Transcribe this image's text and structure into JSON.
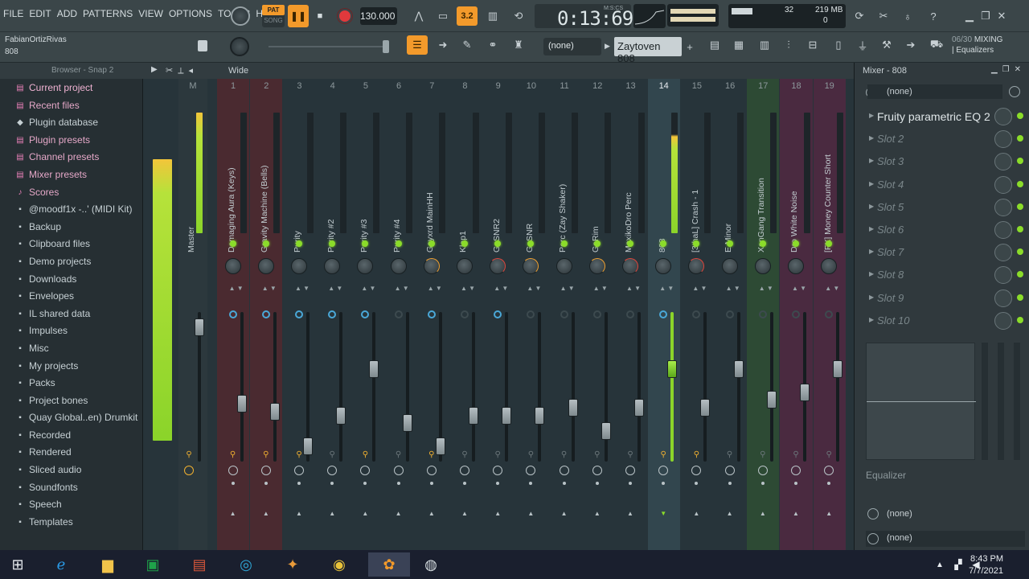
{
  "menus": [
    "FILE",
    "EDIT",
    "ADD",
    "PATTERNS",
    "VIEW",
    "OPTIONS",
    "TOOLS",
    "HELP"
  ],
  "transport": {
    "pat": "PAT",
    "song": "SONG",
    "tempo": "130.000",
    "time": "0:13:69",
    "time_unit": "M:S:CS",
    "step": "3.2"
  },
  "monitor": {
    "cpu_value": "32",
    "ram": "219 MB",
    "polyphony": "0"
  },
  "hint": {
    "user": "FabianOrtizRivas",
    "channel": "808"
  },
  "pattern": {
    "selector": "(none)",
    "name": "Zaytoven 808"
  },
  "mixing_info": {
    "count": "06/30",
    "mode": "MIXING",
    "sub": "| Equalizers"
  },
  "browser": {
    "title": "Browser - Snap 2",
    "items": [
      {
        "label": "Current project",
        "kind": "cur",
        "icon": "▤"
      },
      {
        "label": "Recent files",
        "kind": "pink",
        "icon": "▤"
      },
      {
        "label": "Plugin database",
        "kind": "normal",
        "icon": "◆"
      },
      {
        "label": "Plugin presets",
        "kind": "pink",
        "icon": "▤"
      },
      {
        "label": "Channel presets",
        "kind": "pink",
        "icon": "▤"
      },
      {
        "label": "Mixer presets",
        "kind": "pink",
        "icon": "▤"
      },
      {
        "label": "Scores",
        "kind": "pink",
        "icon": "♪"
      },
      {
        "label": "@moodf1x -..' (MIDI Kit)",
        "kind": "normal",
        "icon": "▪"
      },
      {
        "label": "Backup",
        "kind": "normal",
        "icon": "▪"
      },
      {
        "label": "Clipboard files",
        "kind": "normal",
        "icon": "▪"
      },
      {
        "label": "Demo projects",
        "kind": "normal",
        "icon": "▪"
      },
      {
        "label": "Downloads",
        "kind": "normal",
        "icon": "▪"
      },
      {
        "label": "Envelopes",
        "kind": "normal",
        "icon": "▪"
      },
      {
        "label": "IL shared data",
        "kind": "normal",
        "icon": "▪"
      },
      {
        "label": "Impulses",
        "kind": "normal",
        "icon": "▪"
      },
      {
        "label": "Misc",
        "kind": "normal",
        "icon": "▪"
      },
      {
        "label": "My projects",
        "kind": "normal",
        "icon": "▪"
      },
      {
        "label": "Packs",
        "kind": "normal",
        "icon": "▪"
      },
      {
        "label": "Project bones",
        "kind": "normal",
        "icon": "▪"
      },
      {
        "label": "Quay Global..en) Drumkit",
        "kind": "normal",
        "icon": "▪"
      },
      {
        "label": "Recorded",
        "kind": "normal",
        "icon": "▪"
      },
      {
        "label": "Rendered",
        "kind": "normal",
        "icon": "▪"
      },
      {
        "label": "Sliced audio",
        "kind": "normal",
        "icon": "▪"
      },
      {
        "label": "Soundfonts",
        "kind": "normal",
        "icon": "▪"
      },
      {
        "label": "Speech",
        "kind": "normal",
        "icon": "▪"
      },
      {
        "label": "Templates",
        "kind": "normal",
        "icon": "▪"
      }
    ]
  },
  "mixer": {
    "view": "Wide",
    "master": {
      "num": "M",
      "name": "Master"
    },
    "tracks": [
      {
        "num": "1",
        "name": "Damaging Aura (Keys)",
        "fader": 0.33,
        "tint": "#4a2a30",
        "stereo": true
      },
      {
        "num": "2",
        "name": "Gravity Machine (Bells)",
        "fader": 0.27,
        "tint": "#4a2a30",
        "stereo": true
      },
      {
        "num": "3",
        "name": "Purity",
        "fader": 0.0,
        "tint": "",
        "stereo": true
      },
      {
        "num": "4",
        "name": "Purity #2",
        "fader": 0.24,
        "tint": "",
        "stereo": true
      },
      {
        "num": "5",
        "name": "Purity #3",
        "fader": 0.6,
        "tint": "",
        "stereo": true
      },
      {
        "num": "6",
        "name": "Purity #4",
        "fader": 0.18,
        "tint": "",
        "stereo": false
      },
      {
        "num": "7",
        "name": "Goyxrd MainHH",
        "fader": 0.0,
        "tint": "",
        "stereo": true
      },
      {
        "num": "8",
        "name": "Klap1",
        "fader": 0.24,
        "tint": "",
        "stereo": false
      },
      {
        "num": "9",
        "name": "GoSNR2",
        "fader": 0.24,
        "tint": "",
        "stereo": true
      },
      {
        "num": "10",
        "name": "GoSNR",
        "fader": 0.24,
        "tint": "",
        "stereo": false
      },
      {
        "num": "11",
        "name": "Perc (Zay Shaker)",
        "fader": 0.3,
        "tint": "",
        "stereo": false
      },
      {
        "num": "12",
        "name": "GoRim",
        "fader": 0.12,
        "tint": "",
        "stereo": false
      },
      {
        "num": "13",
        "name": "MexikoDro Perc",
        "fader": 0.3,
        "tint": "",
        "stereo": false
      },
      {
        "num": "14",
        "name": "808",
        "fader": 0.6,
        "tint": "#2c3c42",
        "stereo": true,
        "selected": true
      },
      {
        "num": "15",
        "name": "[3thaL] Crash - 1",
        "fader": 0.3,
        "tint": "",
        "stereo": false
      },
      {
        "num": "16",
        "name": "E Minor",
        "fader": 0.6,
        "tint": "",
        "stereo": false
      },
      {
        "num": "17",
        "name": "XanGang Transition",
        "fader": 0.36,
        "tint": "#2d4a34",
        "stereo": false
      },
      {
        "num": "18",
        "name": "Dro White Noise",
        "fader": 0.42,
        "tint": "#4a2a40",
        "stereo": false
      },
      {
        "num": "19",
        "name": "[FX] Money Counter Short",
        "fader": 0.6,
        "tint": "#4a2a40",
        "stereo": false
      }
    ]
  },
  "rpanel": {
    "title": "Mixer - 808",
    "preset": "(none)",
    "slots": [
      "Fruity parametric EQ 2",
      "Slot 2",
      "Slot 3",
      "Slot 4",
      "Slot 5",
      "Slot 6",
      "Slot 7",
      "Slot 8",
      "Slot 9",
      "Slot 10"
    ],
    "eq_label": "Equalizer",
    "out1": "(none)",
    "out2": "(none)"
  },
  "taskbar": {
    "time": "8:43 PM",
    "date": "7/7/2021"
  }
}
